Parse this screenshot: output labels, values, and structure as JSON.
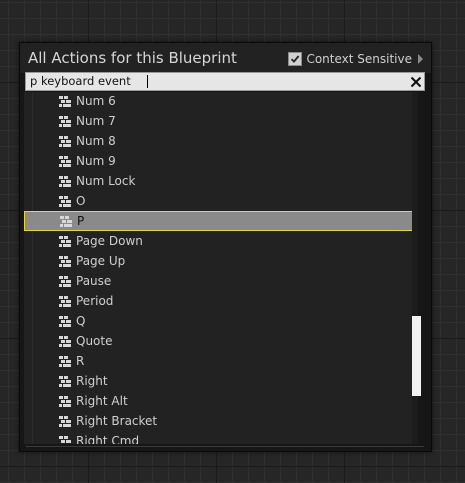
{
  "panel": {
    "title": "All Actions for this Blueprint",
    "context_sensitive": {
      "label": "Context Sensitive",
      "checked": true
    }
  },
  "search": {
    "value": "p keyboard event",
    "placeholder": ""
  },
  "items": [
    {
      "label": "Num 6",
      "icon": "key-event-icon"
    },
    {
      "label": "Num 7",
      "icon": "key-event-icon"
    },
    {
      "label": "Num 8",
      "icon": "key-event-icon"
    },
    {
      "label": "Num 9",
      "icon": "key-event-icon"
    },
    {
      "label": "Num Lock",
      "icon": "key-event-icon"
    },
    {
      "label": "O",
      "icon": "key-event-icon"
    },
    {
      "label": "P",
      "icon": "key-event-icon",
      "selected": true
    },
    {
      "label": "Page Down",
      "icon": "key-event-icon"
    },
    {
      "label": "Page Up",
      "icon": "key-event-icon"
    },
    {
      "label": "Pause",
      "icon": "key-event-icon"
    },
    {
      "label": "Period",
      "icon": "key-event-icon"
    },
    {
      "label": "Q",
      "icon": "key-event-icon"
    },
    {
      "label": "Quote",
      "icon": "key-event-icon"
    },
    {
      "label": "R",
      "icon": "key-event-icon"
    },
    {
      "label": "Right",
      "icon": "key-event-icon"
    },
    {
      "label": "Right Alt",
      "icon": "key-event-icon"
    },
    {
      "label": "Right Bracket",
      "icon": "key-event-icon"
    },
    {
      "label": "Right Cmd",
      "icon": "key-event-icon"
    }
  ],
  "colors": {
    "selection_border": "#e8d43a",
    "selection_fill": "#8a8a8a",
    "panel_bg": "#161616"
  }
}
